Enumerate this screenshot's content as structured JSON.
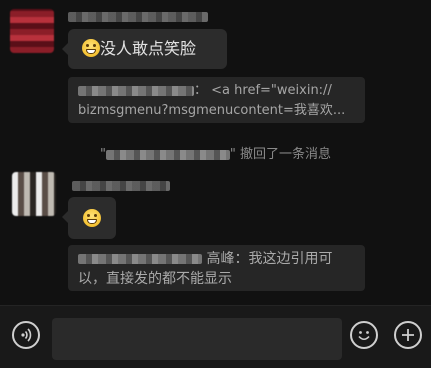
{
  "messages": [
    {
      "id": "msg1",
      "text": "没人敢点笑脸",
      "emoji": "grin-emoji"
    },
    {
      "id": "quote1",
      "prefix": "：",
      "text_line1": "<a href=\"weixin://",
      "text_line2": "bizmsgmenu?msgmenucontent=我喜欢..."
    },
    {
      "id": "recall",
      "open_quote": "\"",
      "close_quote": "\"",
      "text": "撤回了一条消息"
    },
    {
      "id": "msg2",
      "emoji": "grin-emoji"
    },
    {
      "id": "quote2",
      "text_line1": "高峰：我这边引用可",
      "text_line2": "以，直接发的都不能显示"
    }
  ],
  "input_bar": {
    "voice_icon": "voice-icon",
    "emoji_icon": "smiley-icon",
    "plus_icon": "plus-icon",
    "value": ""
  },
  "colors": {
    "background": "#111111",
    "bubble": "#2c2c2c",
    "quote": "#262626"
  }
}
